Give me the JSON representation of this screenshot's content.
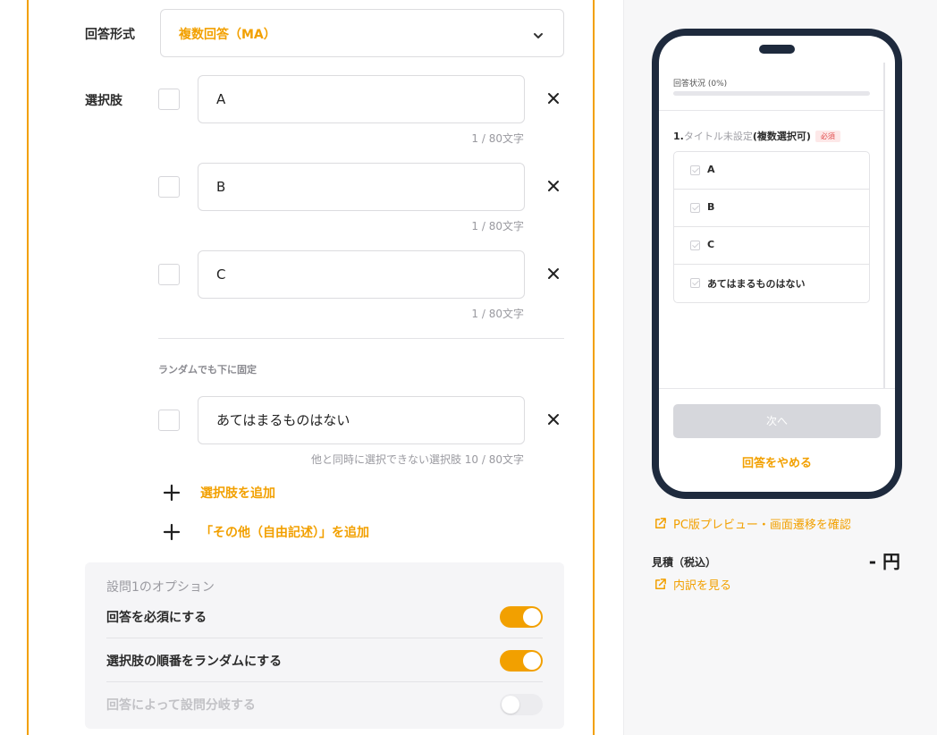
{
  "form": {
    "format_label": "回答形式",
    "format_value": "複数回答（MA）",
    "choices_label": "選択肢",
    "choices": [
      {
        "value": "A",
        "count": "1 / 80文字"
      },
      {
        "value": "B",
        "count": "1 / 80文字"
      },
      {
        "value": "C",
        "count": "1 / 80文字"
      }
    ],
    "fixed_section_label": "ランダムでも下に固定",
    "fixed_choice": {
      "value": "あてはまるものはない",
      "count": "他と同時に選択できない選択肢  10 / 80文字"
    },
    "add_choice_label": "選択肢を追加",
    "add_other_label": "「その他（自由記述）」を追加"
  },
  "options": {
    "title": "設問1のオプション",
    "rows": [
      {
        "label": "回答を必須にする",
        "on": true,
        "disabled": false
      },
      {
        "label": "選択肢の順番をランダムにする",
        "on": true,
        "disabled": false
      },
      {
        "label": "回答によって設問分岐する",
        "on": false,
        "disabled": true
      }
    ]
  },
  "preview": {
    "progress_label": "回答状況 (0%)",
    "progress_value": 0,
    "question_num": "1.",
    "question_title": "タイトル未設定",
    "question_suffix": "(複数選択可)",
    "required_badge": "必須",
    "choices": [
      "A",
      "B",
      "C",
      "あてはまるものはない"
    ],
    "next_button": "次へ",
    "quit_link": "回答をやめる"
  },
  "sidebar": {
    "pc_preview_link": "PC版プレビュー・画面遷移を確認",
    "estimate_label": "見積（税込）",
    "estimate_value": "- 円",
    "breakdown_link": "内訳を見る"
  },
  "colors": {
    "accent": "#f2a000",
    "phone_frame": "#1e2a3d",
    "required": "#e24b4b"
  }
}
